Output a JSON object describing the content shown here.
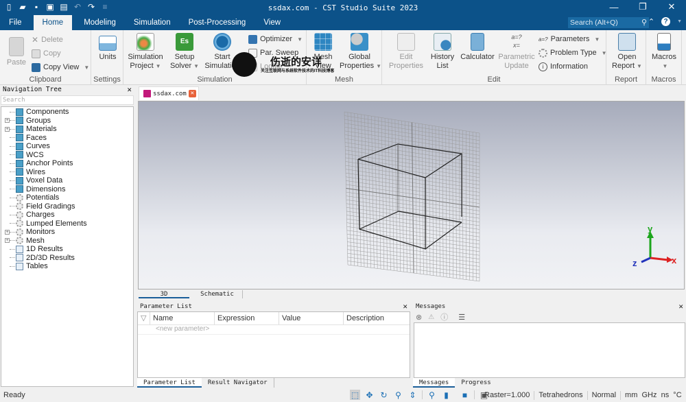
{
  "window": {
    "title": "ssdax.com - CST Studio Suite 2023",
    "controls": {
      "minimize": "—",
      "restore": "❐",
      "close": "✕"
    }
  },
  "quick_access": [
    {
      "name": "new-file-icon",
      "glyph": "▯"
    },
    {
      "name": "open-folder-icon",
      "glyph": "▰"
    },
    {
      "name": "save-icon",
      "glyph": "▪"
    },
    {
      "name": "save-all-icon",
      "glyph": "▣"
    },
    {
      "name": "print-icon",
      "glyph": "▤"
    },
    {
      "name": "undo-icon",
      "glyph": "↶"
    },
    {
      "name": "redo-icon",
      "glyph": "↷"
    },
    {
      "name": "customize-icon",
      "glyph": "≡"
    }
  ],
  "menu_tabs": [
    {
      "label": "File",
      "active": false
    },
    {
      "label": "Home",
      "active": true
    },
    {
      "label": "Modeling",
      "active": false
    },
    {
      "label": "Simulation",
      "active": false
    },
    {
      "label": "Post-Processing",
      "active": false
    },
    {
      "label": "View",
      "active": false
    }
  ],
  "search": {
    "placeholder": "Search (Alt+Q)"
  },
  "ribbon": {
    "clipboard": {
      "label": "Clipboard",
      "paste": "Paste",
      "delete": "Delete",
      "copy": "Copy",
      "copy_view": "Copy View"
    },
    "settings": {
      "label": "Settings",
      "units": "Units"
    },
    "simulation": {
      "label": "Simulation",
      "simulation_project": [
        "Simulation",
        "Project"
      ],
      "setup_solver": [
        "Setup",
        "Solver"
      ],
      "start_simulation": [
        "Start",
        "Simulation"
      ],
      "optimizer": "Optimizer",
      "par_sweep": "Par. Sweep",
      "logfile": "Logfile"
    },
    "mesh": {
      "label": "Mesh",
      "mesh_view": [
        "Mesh",
        "View"
      ],
      "global_properties": [
        "Global",
        "Properties"
      ]
    },
    "edit": {
      "label": "Edit",
      "edit_properties": [
        "Edit",
        "Properties"
      ],
      "history_list": [
        "History",
        "List"
      ],
      "calculator": "Calculator",
      "parametric_update": [
        "Parametric",
        "Update"
      ],
      "parameters": "Parameters",
      "problem_type": "Problem Type",
      "information": "Information"
    },
    "report": {
      "label": "Report",
      "open_report": [
        "Open",
        "Report"
      ]
    },
    "macros": {
      "label": "Macros",
      "macros": "Macros"
    }
  },
  "navigation_tree": {
    "title": "Navigation Tree",
    "search_placeholder": "Search",
    "items": [
      {
        "label": "Components",
        "icon": "cube",
        "expandable": false
      },
      {
        "label": "Groups",
        "icon": "cube",
        "expandable": true
      },
      {
        "label": "Materials",
        "icon": "cube",
        "expandable": true
      },
      {
        "label": "Faces",
        "icon": "cube",
        "expandable": false
      },
      {
        "label": "Curves",
        "icon": "cube",
        "expandable": false
      },
      {
        "label": "WCS",
        "icon": "cube",
        "expandable": false
      },
      {
        "label": "Anchor Points",
        "icon": "cube",
        "expandable": false
      },
      {
        "label": "Wires",
        "icon": "cube",
        "expandable": false
      },
      {
        "label": "Voxel Data",
        "icon": "cube",
        "expandable": false
      },
      {
        "label": "Dimensions",
        "icon": "cube",
        "expandable": false
      },
      {
        "label": "Potentials",
        "icon": "gear",
        "expandable": false
      },
      {
        "label": "Field Gradings",
        "icon": "gear",
        "expandable": false
      },
      {
        "label": "Charges",
        "icon": "gear",
        "expandable": false
      },
      {
        "label": "Lumped Elements",
        "icon": "gear",
        "expandable": false
      },
      {
        "label": "Monitors",
        "icon": "gear",
        "expandable": true
      },
      {
        "label": "Mesh",
        "icon": "gear",
        "expandable": true
      },
      {
        "label": "1D Results",
        "icon": "chart",
        "expandable": false
      },
      {
        "label": "2D/3D Results",
        "icon": "chart",
        "expandable": false
      },
      {
        "label": "Tables",
        "icon": "chart",
        "expandable": false
      }
    ]
  },
  "document_tab": {
    "label": "ssdax.com"
  },
  "view_tabs": [
    {
      "label": "3D",
      "active": true
    },
    {
      "label": "Schematic",
      "active": false
    }
  ],
  "axes": {
    "x": "x",
    "y": "y",
    "z": "z"
  },
  "parameter_list": {
    "title": "Parameter List",
    "columns": [
      "Name",
      "Expression",
      "Value",
      "Description"
    ],
    "new_row_placeholder": "<new parameter>",
    "bottom_tabs": [
      {
        "label": "Parameter List",
        "active": true
      },
      {
        "label": "Result Navigator",
        "active": false
      }
    ]
  },
  "messages": {
    "title": "Messages",
    "bottom_tabs": [
      {
        "label": "Messages",
        "active": true
      },
      {
        "label": "Progress",
        "active": false
      }
    ]
  },
  "status_bar": {
    "status": "Ready",
    "raster": "Raster=1.000",
    "mesh_type": "Tetrahedrons",
    "mode": "Normal",
    "units": "mm  GHz  ns  °C"
  },
  "watermark": {
    "title": "伤逝的安详",
    "subtitle": "关注互联网与系统软件技术的IT科技博客"
  }
}
